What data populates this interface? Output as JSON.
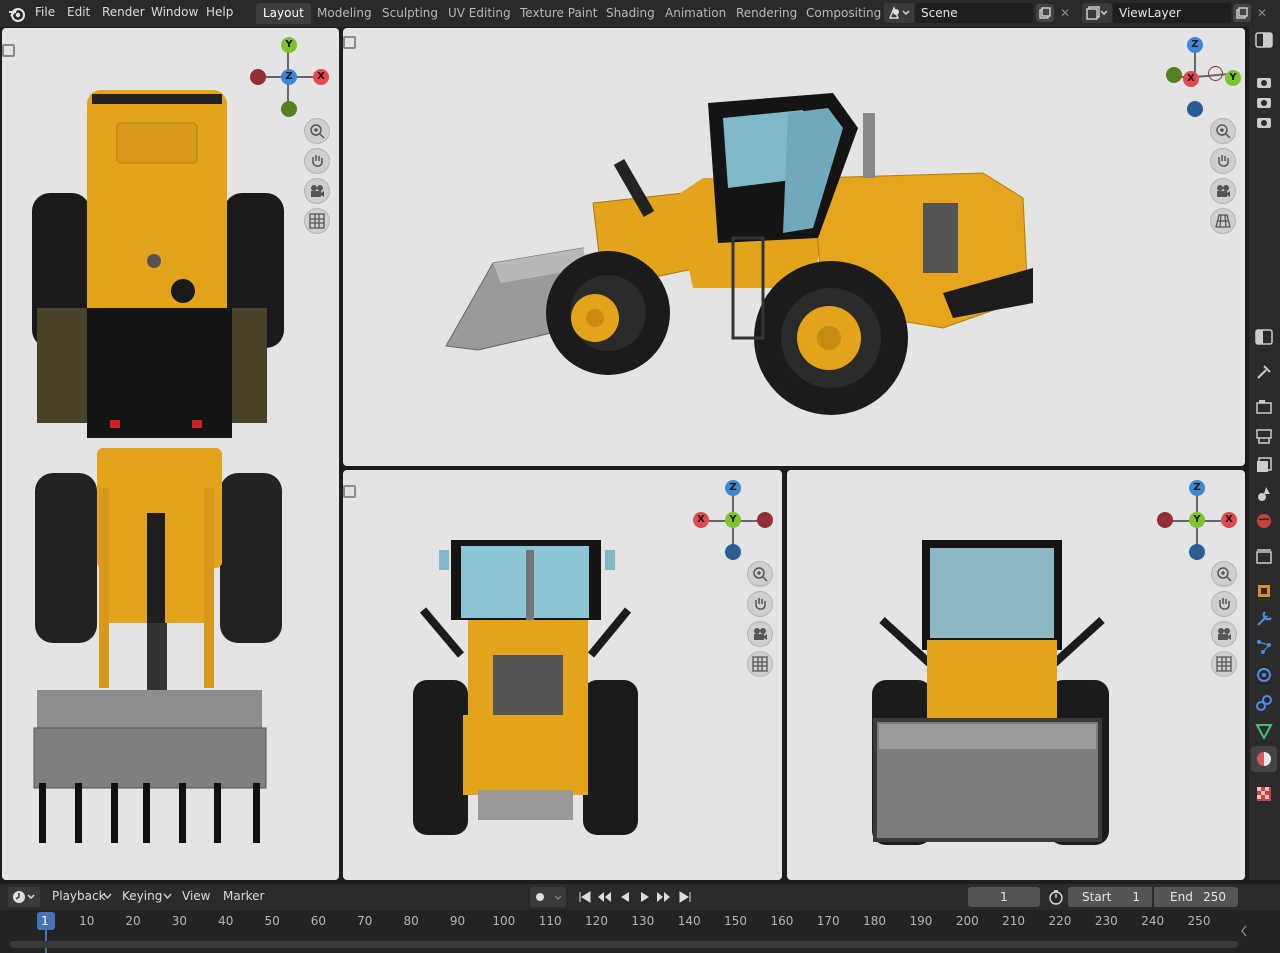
{
  "menu": [
    "File",
    "Edit",
    "Render",
    "Window",
    "Help"
  ],
  "workspaces": [
    "Layout",
    "Modeling",
    "Sculpting",
    "UV Editing",
    "Texture Paint",
    "Shading",
    "Animation",
    "Rendering",
    "Compositing"
  ],
  "active_workspace": "Layout",
  "scene_name": "Scene",
  "view_layer_name": "ViewLayer",
  "gizmo_labels": {
    "x": "X",
    "y": "Y",
    "z": "Z"
  },
  "timeline": {
    "playback_label": "Playback",
    "keying_label": "Keying",
    "view_label": "View",
    "marker_label": "Marker",
    "current_frame": "1",
    "start_label": "Start",
    "start_value": "1",
    "end_label": "End",
    "end_value": "250",
    "ruler_ticks": [
      "1",
      "10",
      "20",
      "30",
      "40",
      "50",
      "60",
      "70",
      "80",
      "90",
      "100",
      "110",
      "120",
      "130",
      "140",
      "150",
      "160",
      "170",
      "180",
      "190",
      "200",
      "210",
      "220",
      "230",
      "240",
      "250"
    ]
  },
  "colors": {
    "accent": "#4772b3",
    "axis_x": "#e5484d",
    "axis_y": "#7dc32e",
    "axis_z": "#3c88d6",
    "loader_yellow": "#e9a614",
    "viewport_bg": "#e4e4e4"
  }
}
